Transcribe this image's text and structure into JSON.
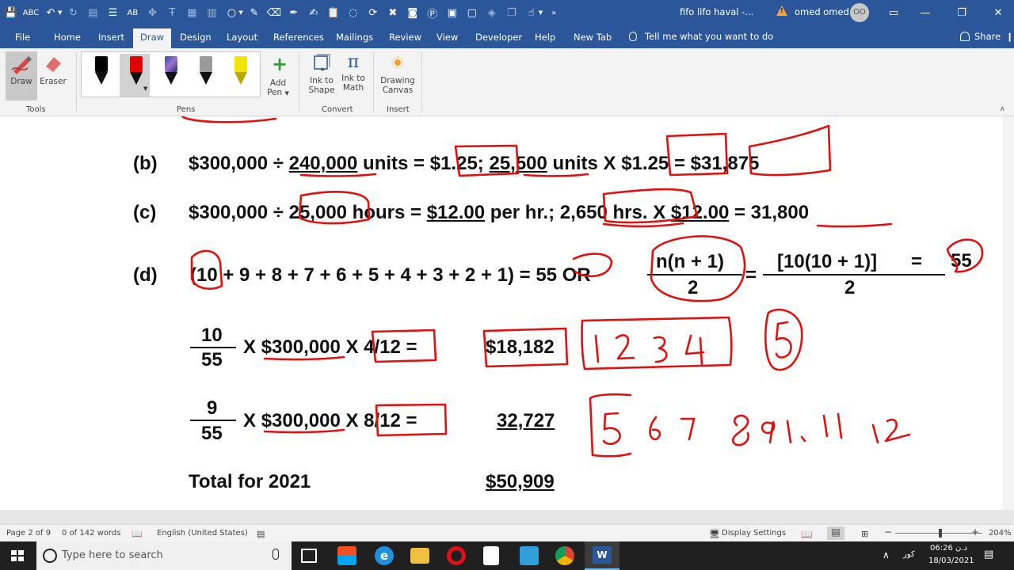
{
  "titlebar": {
    "doc_title": "fifo lifo haval  -...",
    "user_name": "omed omed",
    "user_initials": "OO",
    "more_glyph": "»"
  },
  "menu": {
    "file": "File",
    "home": "Home",
    "insert": "Insert",
    "draw": "Draw",
    "design": "Design",
    "layout": "Layout",
    "references": "References",
    "mailings": "Mailings",
    "review": "Review",
    "view": "View",
    "developer": "Developer",
    "help": "Help",
    "new_tab": "New Tab",
    "tell_me": "Tell me what you want to do",
    "share": "Share"
  },
  "ribbon": {
    "draw_label": "Draw",
    "eraser_label": "Eraser",
    "tools_group": "Tools",
    "pens_group": "Pens",
    "add_pen_line1": "Add",
    "add_pen_line2": "Pen",
    "ink_to_shape_line1": "Ink to",
    "ink_to_shape_line2": "Shape",
    "ink_to_math_line1": "Ink to",
    "ink_to_math_line2": "Math",
    "convert_group": "Convert",
    "drawing_canvas_line1": "Drawing",
    "drawing_canvas_line2": "Canvas",
    "insert_group": "Insert",
    "pen_colors": [
      "#000000",
      "#e00000",
      "#111111",
      "#9a9a9a",
      "#f2e600"
    ]
  },
  "document": {
    "b_label": "(b)",
    "b_p1": "$300,000 ÷ ",
    "b_p2": "240,000",
    "b_p3": " units = ",
    "b_p4": "$1.25",
    "b_p5": "; ",
    "b_p6": "25,500",
    "b_p7": " units X ",
    "b_p8": "$1.25",
    "b_p9": " = ",
    "b_p10": "$31,875",
    "c_label": "(c)",
    "c_p1": "$300,000 ÷ ",
    "c_p2": "25,000",
    "c_p3": " hours = ",
    "c_p4": "$12.00",
    "c_p5": " per hr.; ",
    "c_p6": "2,650 hrs",
    "c_p7": ". X ",
    "c_p8": "$12.00",
    "c_p9": " = ",
    "c_p10": "31,800",
    "d_label": "(d)",
    "d_expr": "(10 + 9 + 8 + 7 + 6 + 5 + 4 + 3 + 2 + 1) = 55 OR",
    "d_frac1_num": "n(n + 1)",
    "d_frac1_den": "2",
    "d_eq": "=",
    "d_frac2_num": "[10(10 + 1)]",
    "d_frac2_den": "2",
    "d_eq2": "=",
    "d_result": "55",
    "r1_num": "10",
    "r1_den": "55",
    "r1_p1": "X ",
    "r1_p2": "$300,000",
    "r1_p3": " X 4/12 =",
    "r1_value": "$18,182",
    "r2_num": "9",
    "r2_den": "55",
    "r2_p1": "X ",
    "r2_p2": "$300,000",
    "r2_p3": " X 8/12 =",
    "r2_value": "32,727",
    "total_label": "Total for 2021",
    "total_value": "$50,909"
  },
  "status": {
    "page": "Page 2 of 9",
    "words": "0 of 142 words",
    "language": "English (United States)",
    "display_settings": "Display Settings",
    "zoom": "204%",
    "minus": "−",
    "plus": "+"
  },
  "taskbar": {
    "search_placeholder": "Type here to search",
    "lang": "کور",
    "time": "06:26 د.ن",
    "date": "18/03/2021"
  }
}
